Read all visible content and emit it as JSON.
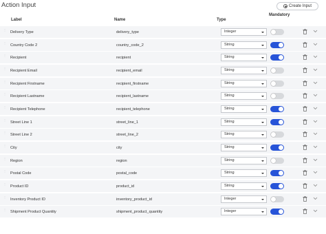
{
  "header": {
    "title": "Action Input",
    "create_button": "Create Input"
  },
  "columns": {
    "label": "Label",
    "name": "Name",
    "type": "Type",
    "mandatory": "Mandatory"
  },
  "rows": [
    {
      "label": "Delivery Type",
      "name": "delivery_type",
      "type": "Integer",
      "mandatory": false
    },
    {
      "label": "Country Code 2",
      "name": "country_code_2",
      "type": "String",
      "mandatory": true
    },
    {
      "label": "Recipient",
      "name": "recipient",
      "type": "String",
      "mandatory": true
    },
    {
      "label": "Recipient Email",
      "name": "recipient_email",
      "type": "String",
      "mandatory": false
    },
    {
      "label": "Recipient Firstname",
      "name": "recipient_firstname",
      "type": "String",
      "mandatory": false
    },
    {
      "label": "Recipient Lastname",
      "name": "recipient_lastname",
      "type": "String",
      "mandatory": false
    },
    {
      "label": "Recipient Telephone",
      "name": "recipient_telephone",
      "type": "String",
      "mandatory": true
    },
    {
      "label": "Street Line 1",
      "name": "street_line_1",
      "type": "String",
      "mandatory": true
    },
    {
      "label": "Street Line 2",
      "name": "street_line_2",
      "type": "String",
      "mandatory": false
    },
    {
      "label": "City",
      "name": "city",
      "type": "String",
      "mandatory": true
    },
    {
      "label": "Region",
      "name": "region",
      "type": "String",
      "mandatory": false
    },
    {
      "label": "Postal Code",
      "name": "postal_code",
      "type": "String",
      "mandatory": true
    },
    {
      "label": "Product ID",
      "name": "product_id",
      "type": "String",
      "mandatory": true
    },
    {
      "label": "Inventory Product ID",
      "name": "inventory_product_id",
      "type": "Integer",
      "mandatory": false
    },
    {
      "label": "Shipment Product Quantity",
      "name": "shipment_product_quantity",
      "type": "Integer",
      "mandatory": true
    }
  ],
  "colors": {
    "toggle_on": "#2754d8",
    "toggle_off": "#d7d9dc",
    "row_background": "#f4f5f7"
  },
  "icons": {
    "row_drag": "drag-handle-icon",
    "delete": "trash-icon",
    "expand": "chevron-down-icon",
    "create": "plus-circle-icon"
  }
}
